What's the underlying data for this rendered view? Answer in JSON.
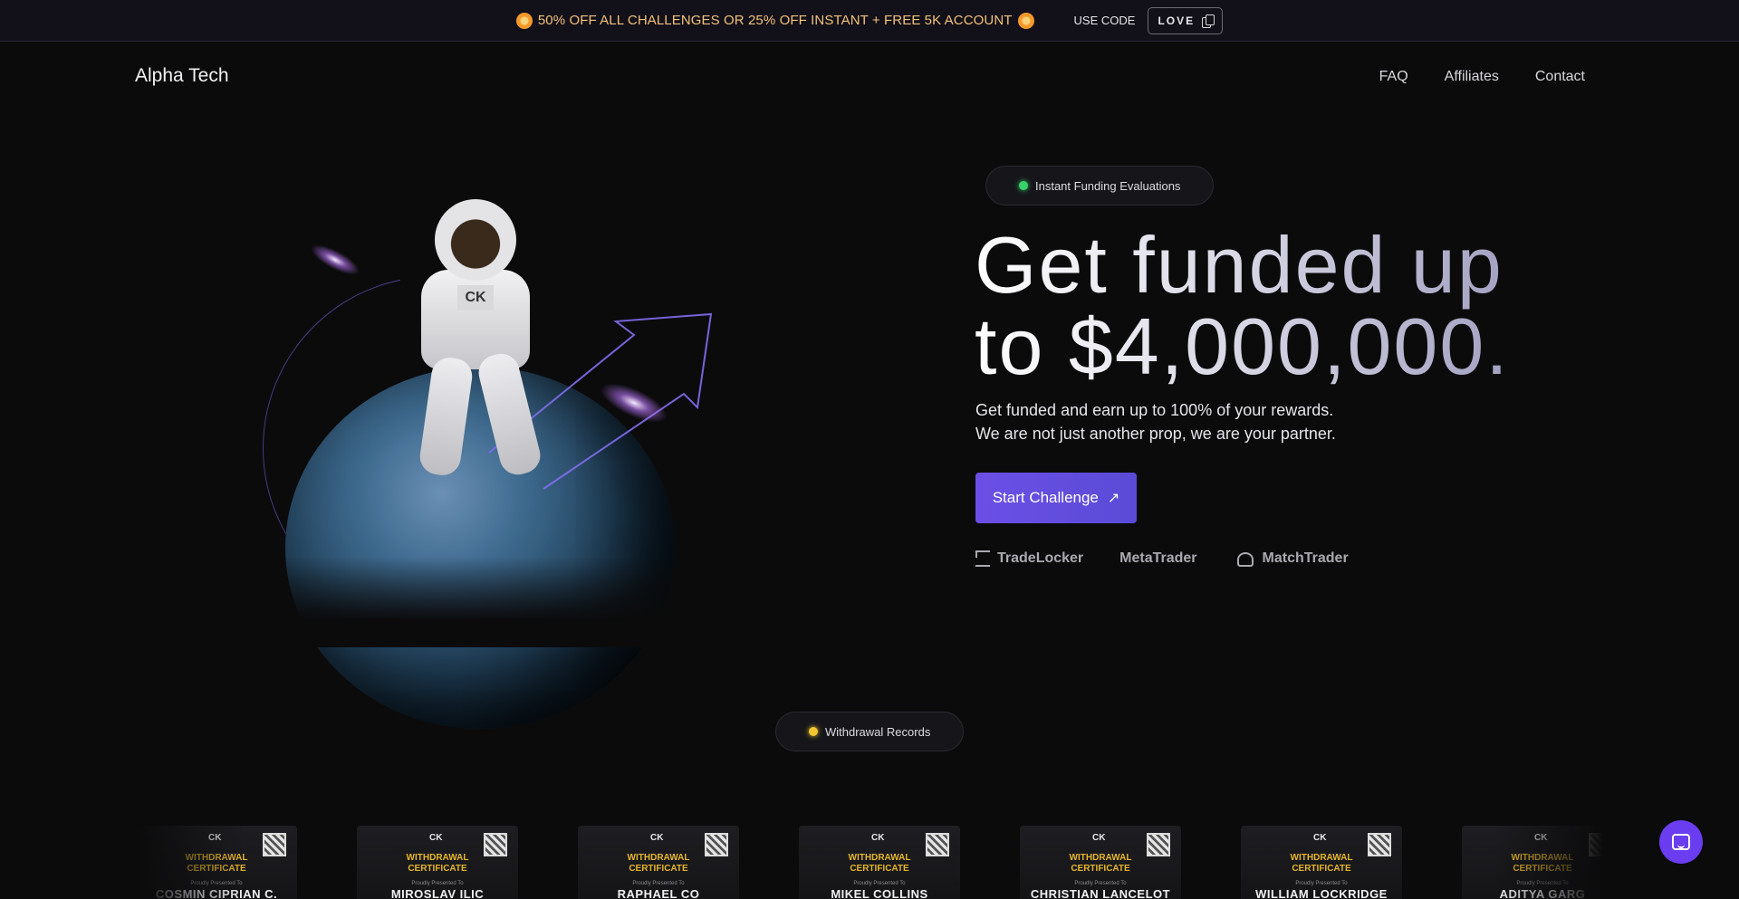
{
  "promo": {
    "text": "50% OFF ALL CHALLENGES OR 25% OFF INSTANT + FREE 5K ACCOUNT",
    "use_code_label": "USE CODE",
    "code": "LOVE",
    "icon": "copy-icon"
  },
  "nav": {
    "brand": "Alpha Tech",
    "links": [
      "FAQ",
      "Affiliates",
      "Contact"
    ]
  },
  "hero": {
    "badge": "Instant Funding Evaluations",
    "headline_line1": "Get funded up",
    "headline_line2": "to $4,000,000.",
    "sub_line1": "Get funded and earn up to 100% of your rewards.",
    "sub_line2": "We are not just another prop, we are your partner.",
    "cta_label": "Start Challenge",
    "cta_icon": "arrow-up-right-icon",
    "platforms": [
      "TradeLocker",
      "MetaTrader",
      "MatchTrader"
    ],
    "illustration_logo": "CK"
  },
  "withdrawals": {
    "badge": "Withdrawal Records",
    "cert_title_line1": "WITHDRAWAL",
    "cert_title_line2": "CERTIFICATE",
    "cert_presented": "Proudly Presented To",
    "cert_logo": "CK",
    "recipients": [
      "COSMIN CIPRIAN C.",
      "MIROSLAV ILIC",
      "RAPHAEL CO",
      "MIKEL COLLINS",
      "CHRISTIAN LANCELOT",
      "WILLIAM LOCKRIDGE",
      "ADITYA GARG"
    ]
  },
  "colors": {
    "accent": "#6b4fe6",
    "promo_text": "#f4c27a",
    "certificate_gold": "#e6b62a",
    "status_green": "#3ad26a",
    "status_yellow": "#f2c532"
  },
  "chat": {
    "icon": "chat-bubble-icon"
  }
}
